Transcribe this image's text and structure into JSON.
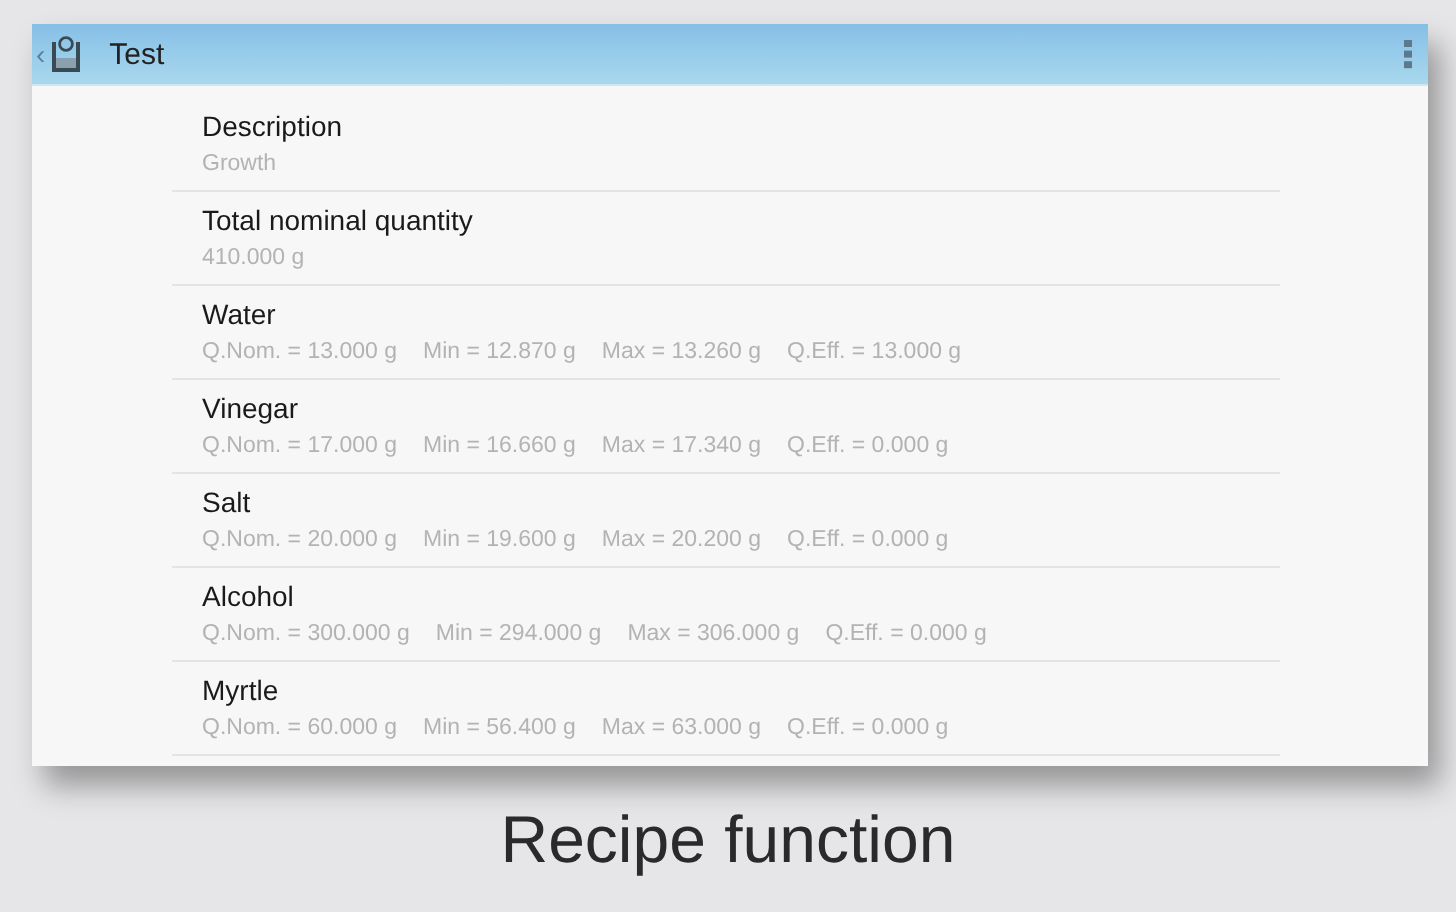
{
  "app_bar": {
    "back": "‹",
    "title": "Test"
  },
  "fields": [
    {
      "label": "Description",
      "value": "Growth"
    },
    {
      "label": "Total nominal quantity",
      "value": "410.000 g"
    }
  ],
  "ingredients": [
    {
      "name": "Water",
      "values": [
        "Q.Nom. = 13.000 g",
        "Min = 12.870 g",
        "Max = 13.260 g",
        "Q.Eff. = 13.000 g"
      ]
    },
    {
      "name": "Vinegar",
      "values": [
        "Q.Nom. = 17.000 g",
        "Min = 16.660 g",
        "Max = 17.340 g",
        "Q.Eff. = 0.000 g"
      ]
    },
    {
      "name": "Salt",
      "values": [
        "Q.Nom. = 20.000 g",
        "Min = 19.600 g",
        "Max = 20.200 g",
        "Q.Eff. = 0.000 g"
      ]
    },
    {
      "name": "Alcohol",
      "values": [
        "Q.Nom. = 300.000 g",
        "Min = 294.000 g",
        "Max = 306.000 g",
        "Q.Eff. = 0.000 g"
      ]
    },
    {
      "name": "Myrtle",
      "values": [
        "Q.Nom. = 60.000 g",
        "Min = 56.400 g",
        "Max = 63.000 g",
        "Q.Eff. = 0.000 g"
      ]
    }
  ],
  "caption": "Recipe function"
}
